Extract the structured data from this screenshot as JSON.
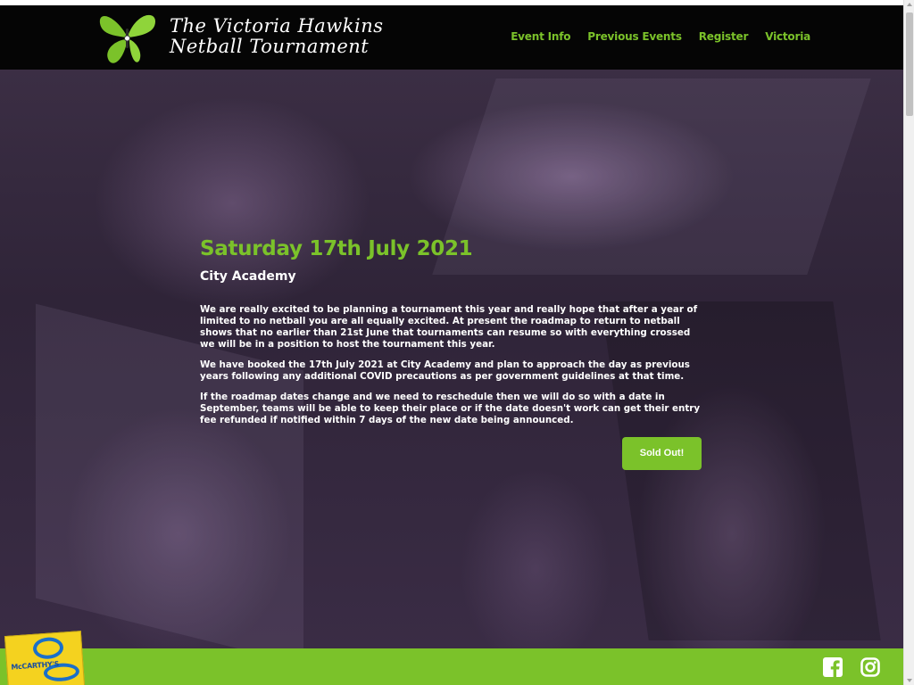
{
  "site": {
    "logo_text_line1": "The Victoria Hawkins",
    "logo_text_line2": "Netball Tournament",
    "logo_icon": "butterfly-icon"
  },
  "nav": {
    "items": [
      {
        "label": "Event Info"
      },
      {
        "label": "Previous Events"
      },
      {
        "label": "Register"
      },
      {
        "label": "Victoria"
      }
    ]
  },
  "event": {
    "title": "Saturday 17th July 2021",
    "venue": "City Academy",
    "paragraphs": [
      "We are really excited to be planning a tournament this year and really hope that after a year of limited to no netball you are all equally excited. At present the roadmap to return to netball shows that no earlier than 21st June that tournaments can resume so with everything crossed we will be in a position to host the tournament this year.",
      "We have booked the 17th July 2021 at City Academy and plan to approach the day as previous years following any additional COVID precautions as per government guidelines at that time.",
      "If the roadmap dates change and we need to reschedule then we will do so with a date in September, teams will be able to keep their place or if the date doesn't work can get their entry fee refunded if notified within 7 days of the new date being announced."
    ],
    "button_label": "Sold Out!"
  },
  "footer": {
    "sponsor_text": "McCARTHY'S",
    "social_icons": [
      "facebook-icon",
      "instagram-icon"
    ]
  },
  "colors": {
    "accent": "#7bc22a",
    "header_bg": "#050505",
    "hero_tint": "#3b2e44",
    "sponsor_yellow": "#f4d21f"
  }
}
